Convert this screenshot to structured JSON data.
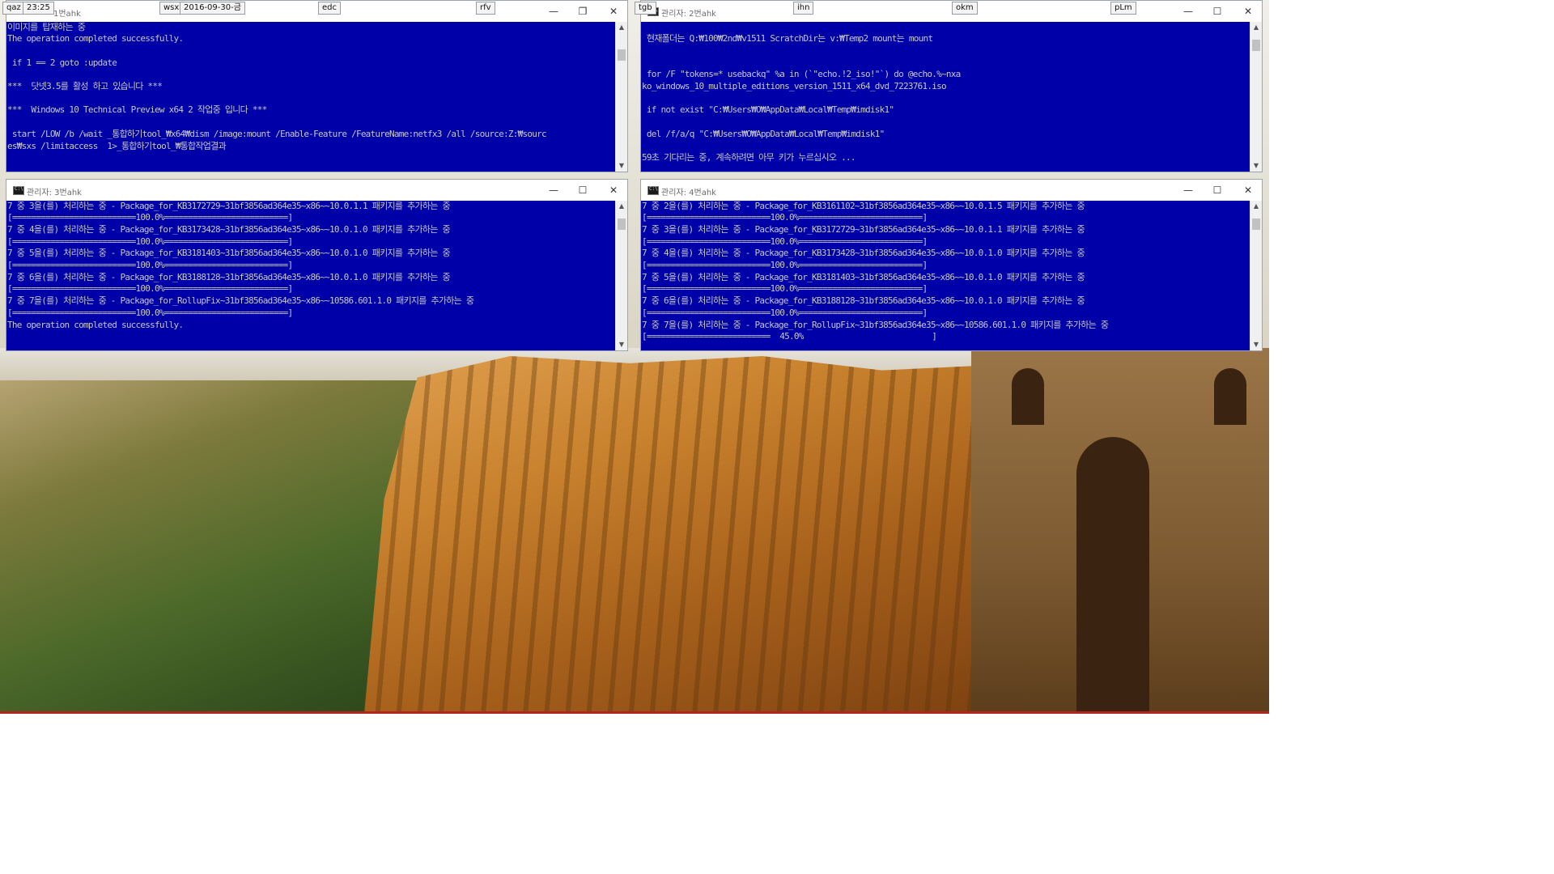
{
  "hotkeys": [
    "qaz",
    "23:25",
    "wsx",
    "2016-09-30-금",
    "edc",
    "rfv",
    "tgb",
    "ihn",
    "okm",
    "pLm"
  ],
  "windows": {
    "w1": {
      "title": "1번ahk",
      "lines": [
        "이미지를 탑재하는 중",
        "The operation completed successfully.",
        "",
        " if 1 == 2 goto :update",
        "",
        "***  닷넷3.5를 활성 하고 있습니다 ***",
        "",
        "***  Windows 10 Technical Preview x64 2 작업중 입니다 ***",
        "",
        " start /LOW /b /wait _통합하기tool_₩x64₩dism /image:mount /Enable-Feature /FeatureName:netfx3 /all /source:Z:₩sourc",
        "es₩sxs /limitaccess  1>_통합하기tool_₩통합작업결과"
      ]
    },
    "w2": {
      "title": "관리자:  2번ahk",
      "lines": [
        "",
        " 현재폴더는 Q:₩100₩2nd₩v1511 ScratchDir는 v:₩Temp2 mount는 mount",
        "",
        "",
        " for /F \"tokens=* usebackq\" %a in (`\"echo.!2_iso!\"`) do @echo.%~nxa",
        "ko_windows_10_multiple_editions_version_1511_x64_dvd_7223761.iso",
        "",
        " if not exist \"C:₩Users₩O₩AppData₩Local₩Temp₩imdisk1\"",
        "",
        " del /f/a/q \"C:₩Users₩O₩AppData₩Local₩Temp₩imdisk1\"",
        "",
        "59초 기다리는 중, 계속하려면 아무 키가 누르십시오 ..."
      ]
    },
    "w3": {
      "title": "관리자:  3번ahk",
      "lines": [
        "7 중 3을(를) 처리하는 중 - Package_for_KB3172729~31bf3856ad364e35~x86~~10.0.1.1 패키지를 추가하는 중",
        "[==========================100.0%==========================]",
        "7 중 4을(를) 처리하는 중 - Package_for_KB3173428~31bf3856ad364e35~x86~~10.0.1.0 패키지를 추가하는 중",
        "[==========================100.0%==========================]",
        "7 중 5을(를) 처리하는 중 - Package_for_KB3181403~31bf3856ad364e35~x86~~10.0.1.0 패키지를 추가하는 중",
        "[==========================100.0%==========================]",
        "7 중 6을(를) 처리하는 중 - Package_for_KB3188128~31bf3856ad364e35~x86~~10.0.1.0 패키지를 추가하는 중",
        "[==========================100.0%==========================]",
        "7 중 7을(를) 처리하는 중 - Package_for_RollupFix~31bf3856ad364e35~x86~~10586.601.1.0 패키지를 추가하는 중",
        "[==========================100.0%==========================]",
        "The operation completed successfully."
      ]
    },
    "w4": {
      "title": "관리자:  4번ahk",
      "lines": [
        "7 중 2을(를) 처리하는 중 - Package_for_KB3161102~31bf3856ad364e35~x86~~10.0.1.5 패키지를 추가하는 중",
        "[==========================100.0%==========================]",
        "7 중 3을(를) 처리하는 중 - Package_for_KB3172729~31bf3856ad364e35~x86~~10.0.1.1 패키지를 추가하는 중",
        "[==========================100.0%==========================]",
        "7 중 4을(를) 처리하는 중 - Package_for_KB3173428~31bf3856ad364e35~x86~~10.0.1.0 패키지를 추가하는 중",
        "[==========================100.0%==========================]",
        "7 중 5을(를) 처리하는 중 - Package_for_KB3181403~31bf3856ad364e35~x86~~10.0.1.0 패키지를 추가하는 중",
        "[==========================100.0%==========================]",
        "7 중 6을(를) 처리하는 중 - Package_for_KB3188128~31bf3856ad364e35~x86~~10.0.1.0 패키지를 추가하는 중",
        "[==========================100.0%==========================]",
        "7 중 7을(를) 처리하는 중 - Package_for_RollupFix~31bf3856ad364e35~x86~~10586.601.1.0 패키지를 추가하는 중",
        "[==========================  45.0%                           ]"
      ]
    }
  },
  "controls": {
    "minimize": "—",
    "maximize": "☐",
    "restore": "❐",
    "close": "✕"
  },
  "colors": {
    "console_bg": "#0000a8",
    "console_fg": "#c8c8c8"
  }
}
